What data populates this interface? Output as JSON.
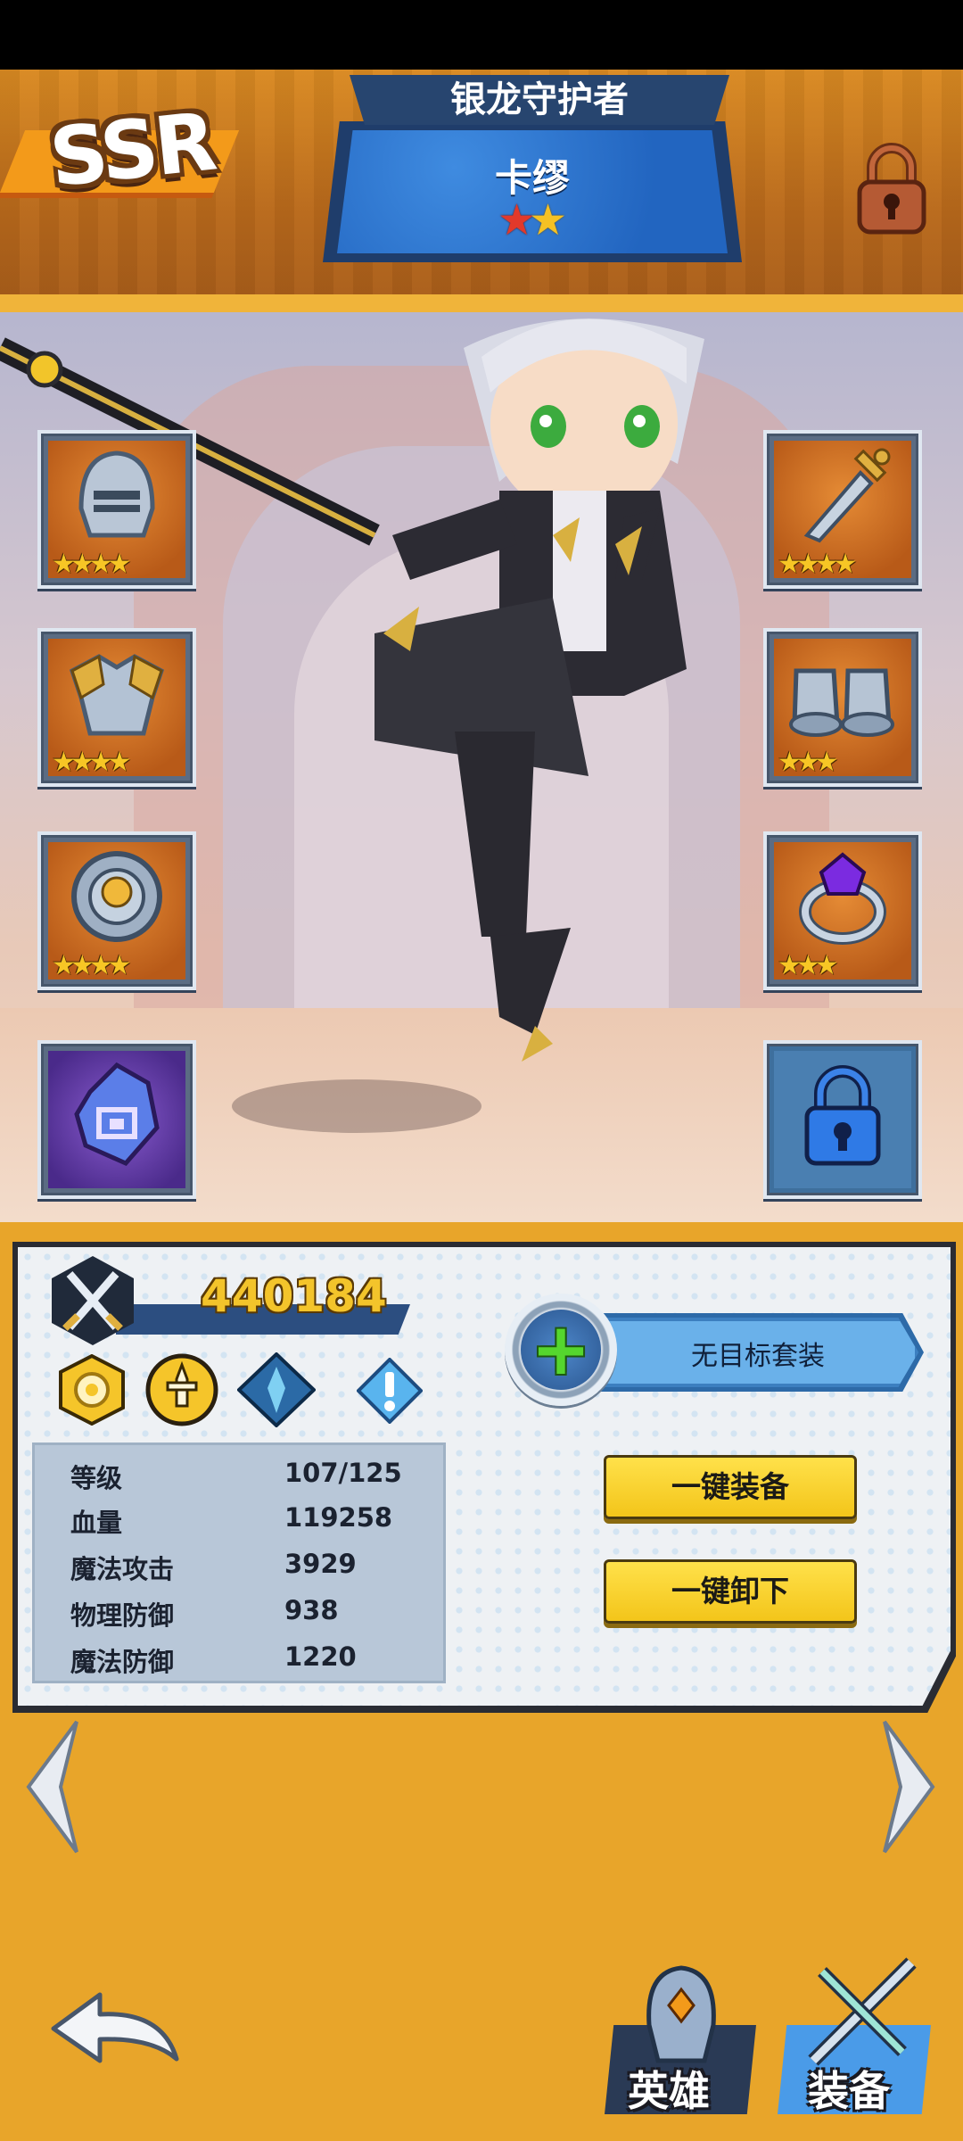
{
  "header": {
    "rarity": "SSR",
    "title": "银龙守护者",
    "hero_name": "卡缪",
    "hero_stars": 2
  },
  "equipment": {
    "left": [
      {
        "name": "helmet",
        "stars": "★★★★"
      },
      {
        "name": "armor",
        "stars": "★★★★"
      },
      {
        "name": "shield",
        "stars": "★★★★"
      },
      {
        "name": "rune-crystal",
        "stars": ""
      }
    ],
    "right": [
      {
        "name": "sword",
        "stars": "★★★★"
      },
      {
        "name": "boots",
        "stars": "★★★"
      },
      {
        "name": "ring",
        "stars": "★★★"
      },
      {
        "name": "locked-slot",
        "stars": ""
      }
    ]
  },
  "info": {
    "power": "440184",
    "stats": [
      {
        "label": "等级",
        "value": "107/125"
      },
      {
        "label": "血量",
        "value": "119258"
      },
      {
        "label": "魔法攻击",
        "value": "3929"
      },
      {
        "label": "物理防御",
        "value": "938"
      },
      {
        "label": "魔法防御",
        "value": "1220"
      }
    ],
    "set_label": "无目标套装",
    "equip_all": "一键装备",
    "unequip_all": "一键卸下"
  },
  "nav": {
    "hero_label": "英雄",
    "equip_label": "装备"
  },
  "colors": {
    "background": "#e8a52a",
    "panel": "#eef1f4",
    "button_yellow": "#f3c51a",
    "title_blue": "#2265c0"
  }
}
